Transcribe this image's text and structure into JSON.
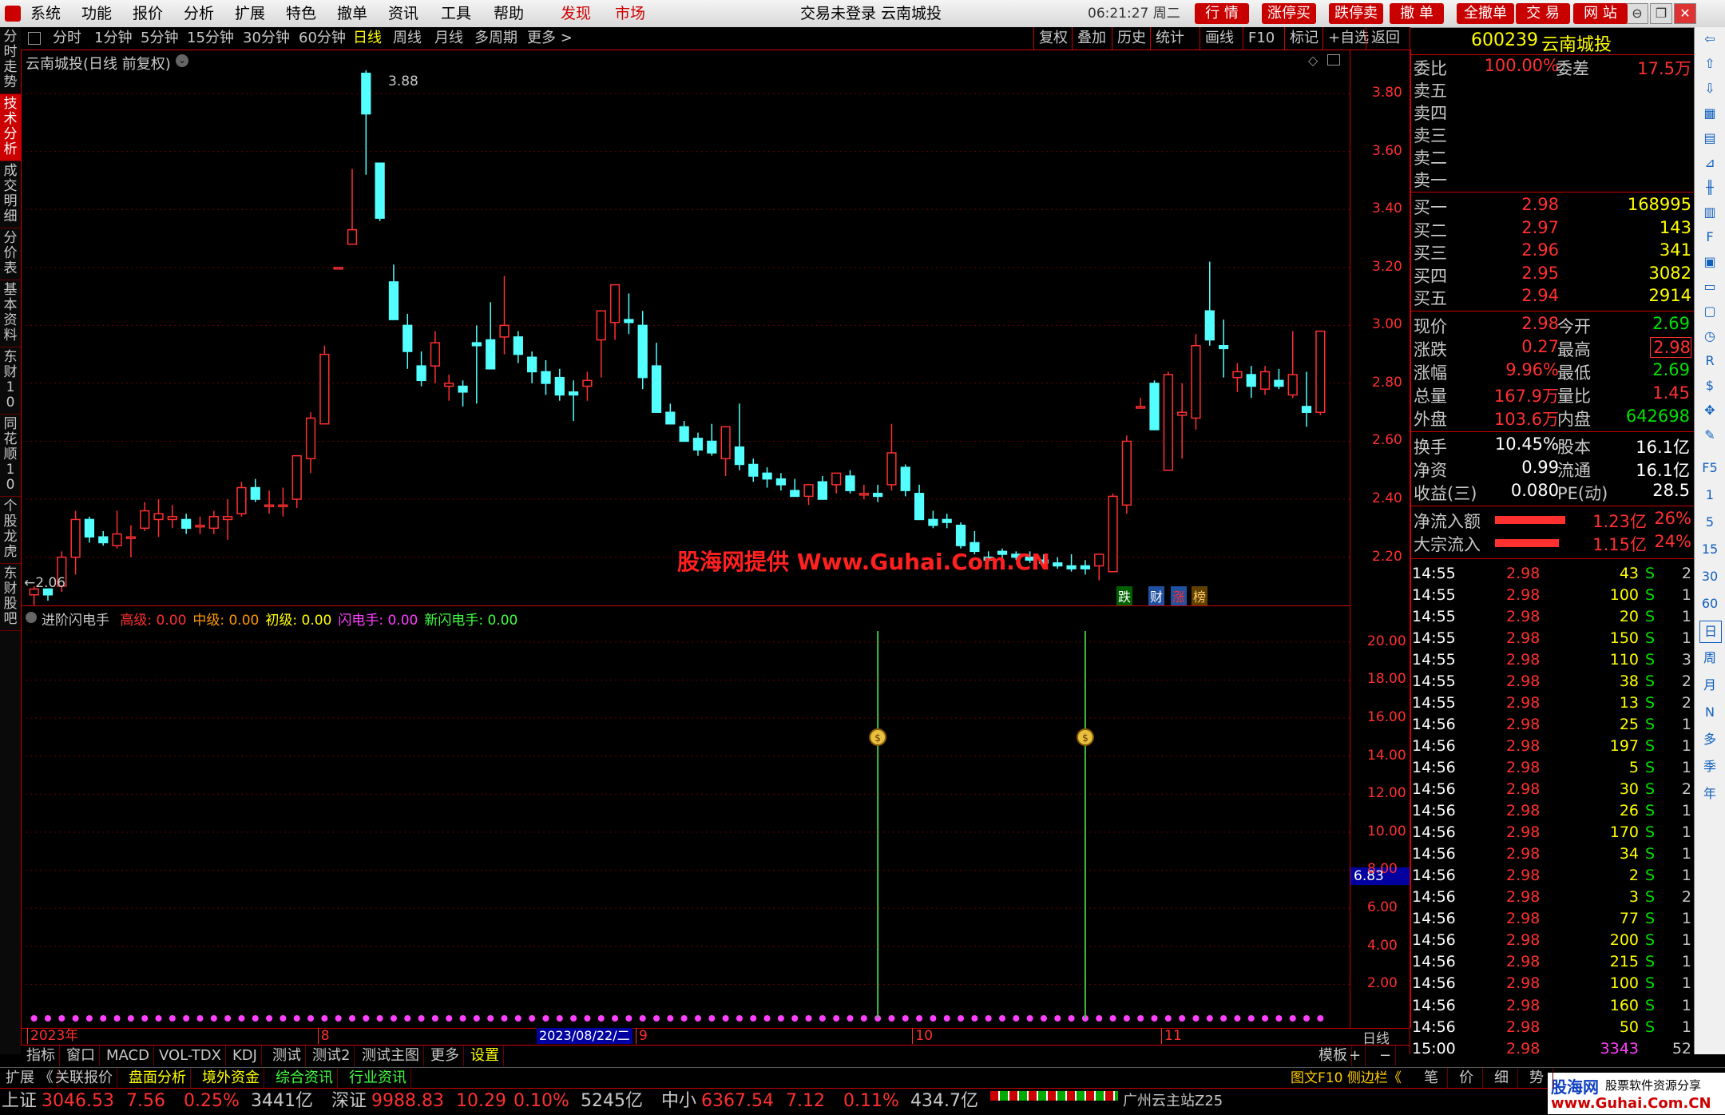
{
  "menu": {
    "items": [
      "系统",
      "功能",
      "报价",
      "分析",
      "扩展",
      "特色",
      "撤单",
      "资讯",
      "工具",
      "帮助"
    ],
    "highlight_items": [
      "发现",
      "市场"
    ],
    "window_title": "交易未登录  云南城投",
    "clock": "06:21:27 周二",
    "trade_buttons": [
      "行 情",
      "涨停买",
      "跌停卖",
      "撤 单",
      "全撤单",
      "交 易",
      "网 站"
    ]
  },
  "left_tabs": [
    "分时走势",
    "技术分析",
    "成交明细",
    "分价表",
    "基本资料",
    "东财10",
    "同花顺10",
    "个股龙虎",
    "东财股吧"
  ],
  "periods": [
    "分时",
    "1分钟",
    "5分钟",
    "15分钟",
    "30分钟",
    "60分钟",
    "日线",
    "周线",
    "月线",
    "多周期",
    "更多 >"
  ],
  "active_period": "日线",
  "tools": [
    "复权",
    "叠加",
    "历史",
    "统计",
    "画线",
    "F10",
    "标记",
    "+自选",
    "返回"
  ],
  "main_chart": {
    "title": "云南城投(日线 前复权)",
    "high_label": "3.88",
    "low_label": "2.06",
    "watermark": "股海网提供 Www.Guhai.Com.CN",
    "tags": [
      "跌",
      "财",
      "涨",
      "榜"
    ],
    "y_ticks": [
      "3.80",
      "3.60",
      "3.40",
      "3.20",
      "3.00",
      "2.80",
      "2.60",
      "2.40",
      "2.20"
    ]
  },
  "chart_data": {
    "type": "candlestick",
    "ylim": [
      2.05,
      3.93
    ],
    "candles": [
      [
        2.07,
        2.1,
        2.03,
        2.09
      ],
      [
        2.09,
        2.09,
        2.05,
        2.07
      ],
      [
        2.1,
        2.22,
        2.08,
        2.2
      ],
      [
        2.2,
        2.36,
        2.14,
        2.33
      ],
      [
        2.33,
        2.34,
        2.25,
        2.27
      ],
      [
        2.27,
        2.29,
        2.24,
        2.25
      ],
      [
        2.24,
        2.36,
        2.23,
        2.28
      ],
      [
        2.27,
        2.31,
        2.2,
        2.27
      ],
      [
        2.3,
        2.39,
        2.29,
        2.36
      ],
      [
        2.33,
        2.4,
        2.27,
        2.35
      ],
      [
        2.33,
        2.38,
        2.3,
        2.34
      ],
      [
        2.33,
        2.35,
        2.28,
        2.3
      ],
      [
        2.31,
        2.34,
        2.28,
        2.31
      ],
      [
        2.3,
        2.36,
        2.28,
        2.34
      ],
      [
        2.33,
        2.4,
        2.26,
        2.34
      ],
      [
        2.35,
        2.46,
        2.34,
        2.44
      ],
      [
        2.44,
        2.47,
        2.39,
        2.4
      ],
      [
        2.38,
        2.43,
        2.35,
        2.38
      ],
      [
        2.38,
        2.44,
        2.34,
        2.38
      ],
      [
        2.4,
        2.52,
        2.37,
        2.55
      ],
      [
        2.54,
        2.7,
        2.49,
        2.68
      ],
      [
        2.66,
        2.93,
        2.66,
        2.9
      ],
      [
        3.2,
        3.2,
        3.2,
        3.2
      ],
      [
        3.28,
        3.54,
        3.33,
        3.33
      ],
      [
        3.87,
        3.88,
        3.52,
        3.73
      ],
      [
        3.56,
        3.56,
        3.36,
        3.37
      ],
      [
        3.15,
        3.21,
        3.03,
        3.02
      ],
      [
        3.0,
        3.04,
        2.85,
        2.91
      ],
      [
        2.86,
        2.91,
        2.79,
        2.81
      ],
      [
        2.86,
        2.98,
        2.8,
        2.94
      ],
      [
        2.79,
        2.83,
        2.74,
        2.8
      ],
      [
        2.79,
        2.81,
        2.72,
        2.77
      ],
      [
        2.94,
        3.0,
        2.73,
        2.93
      ],
      [
        2.95,
        3.08,
        2.91,
        2.85
      ],
      [
        2.96,
        3.17,
        2.9,
        3.0
      ],
      [
        2.96,
        2.98,
        2.87,
        2.9
      ],
      [
        2.89,
        2.91,
        2.8,
        2.84
      ],
      [
        2.84,
        2.88,
        2.76,
        2.8
      ],
      [
        2.82,
        2.85,
        2.74,
        2.76
      ],
      [
        2.77,
        2.81,
        2.67,
        2.76
      ],
      [
        2.79,
        2.84,
        2.74,
        2.81
      ],
      [
        2.95,
        3.0,
        2.82,
        3.05
      ],
      [
        3.01,
        3.13,
        2.95,
        3.14
      ],
      [
        3.02,
        3.11,
        2.97,
        3.01
      ],
      [
        3.0,
        3.05,
        2.78,
        2.82
      ],
      [
        2.86,
        2.94,
        2.74,
        2.7
      ],
      [
        2.7,
        2.73,
        2.66,
        2.66
      ],
      [
        2.65,
        2.67,
        2.6,
        2.6
      ],
      [
        2.61,
        2.63,
        2.55,
        2.57
      ],
      [
        2.6,
        2.66,
        2.55,
        2.56
      ],
      [
        2.54,
        2.61,
        2.48,
        2.65
      ],
      [
        2.58,
        2.73,
        2.5,
        2.52
      ],
      [
        2.52,
        2.54,
        2.46,
        2.48
      ],
      [
        2.49,
        2.51,
        2.44,
        2.47
      ],
      [
        2.47,
        2.49,
        2.43,
        2.45
      ],
      [
        2.43,
        2.47,
        2.41,
        2.41
      ],
      [
        2.41,
        2.45,
        2.38,
        2.45
      ],
      [
        2.46,
        2.48,
        2.4,
        2.4
      ],
      [
        2.45,
        2.49,
        2.42,
        2.49
      ],
      [
        2.48,
        2.5,
        2.42,
        2.43
      ],
      [
        2.42,
        2.45,
        2.4,
        2.42
      ],
      [
        2.42,
        2.45,
        2.39,
        2.41
      ],
      [
        2.45,
        2.66,
        2.43,
        2.56
      ],
      [
        2.51,
        2.52,
        2.41,
        2.43
      ],
      [
        2.42,
        2.45,
        2.33,
        2.33
      ],
      [
        2.33,
        2.36,
        2.3,
        2.31
      ],
      [
        2.33,
        2.35,
        2.3,
        2.32
      ],
      [
        2.31,
        2.32,
        2.23,
        2.24
      ],
      [
        2.25,
        2.29,
        2.21,
        2.22
      ],
      [
        2.2,
        2.22,
        2.19,
        2.19
      ],
      [
        2.22,
        2.23,
        2.19,
        2.21
      ],
      [
        2.21,
        2.22,
        2.19,
        2.2
      ],
      [
        2.2,
        2.22,
        2.18,
        2.19
      ],
      [
        2.19,
        2.21,
        2.17,
        2.18
      ],
      [
        2.18,
        2.2,
        2.16,
        2.17
      ],
      [
        2.17,
        2.21,
        2.15,
        2.16
      ],
      [
        2.17,
        2.19,
        2.14,
        2.16
      ],
      [
        2.17,
        2.2,
        2.12,
        2.21
      ],
      [
        2.15,
        2.42,
        2.15,
        2.41
      ],
      [
        2.38,
        2.62,
        2.35,
        2.6
      ],
      [
        2.72,
        2.75,
        2.72,
        2.72
      ],
      [
        2.8,
        2.81,
        2.64,
        2.64
      ],
      [
        2.5,
        2.84,
        2.5,
        2.83
      ],
      [
        2.69,
        2.8,
        2.54,
        2.7
      ],
      [
        2.68,
        2.97,
        2.64,
        2.93
      ],
      [
        3.05,
        3.22,
        2.93,
        2.95
      ],
      [
        2.93,
        3.02,
        2.82,
        2.92
      ],
      [
        2.82,
        2.87,
        2.77,
        2.84
      ],
      [
        2.83,
        2.86,
        2.75,
        2.79
      ],
      [
        2.78,
        2.86,
        2.76,
        2.84
      ],
      [
        2.81,
        2.85,
        2.78,
        2.79
      ],
      [
        2.76,
        2.98,
        2.75,
        2.83
      ],
      [
        2.72,
        2.84,
        2.65,
        2.7
      ],
      [
        2.7,
        2.98,
        2.69,
        2.98
      ]
    ]
  },
  "indicator": {
    "name": "进阶闪电手",
    "labels": [
      {
        "k": "高级:",
        "v": "0.00",
        "color": "#ff3030"
      },
      {
        "k": "中级:",
        "v": "0.00",
        "color": "#ff9900"
      },
      {
        "k": "初级:",
        "v": "0.00",
        "color": "#ffff00"
      },
      {
        "k": "闪电手:",
        "v": "0.00",
        "color": "#ff40ff"
      },
      {
        "k": "新闪电手:",
        "v": "0.00",
        "color": "#40ff40"
      }
    ],
    "y_ticks": [
      "20.00",
      "18.00",
      "16.00",
      "14.00",
      "12.00",
      "10.00",
      "8.00",
      "6.00",
      "4.00",
      "2.00"
    ],
    "cursor_value": "6.83",
    "signal_positions": [
      61,
      76
    ],
    "ylim": [
      0,
      21.5
    ]
  },
  "date_axis": {
    "labels": [
      {
        "t": "2023年",
        "i": 0
      },
      {
        "t": "8",
        "i": 21
      },
      {
        "t": "9",
        "i": 44
      },
      {
        "t": "10",
        "i": 64
      },
      {
        "t": "11",
        "i": 82
      }
    ],
    "cursor_date": "2023/08/22/二",
    "unit_label": "日线"
  },
  "quote": {
    "code": "600239",
    "name": "云南城投",
    "weibi_label": "委比",
    "weibi": "100.00%",
    "weicha_label": "委差",
    "weicha": "17.5万",
    "sells": [
      "卖五",
      "卖四",
      "卖三",
      "卖二",
      "卖一"
    ],
    "buys": [
      {
        "l": "买一",
        "p": "2.98",
        "v": "168995"
      },
      {
        "l": "买二",
        "p": "2.97",
        "v": "143"
      },
      {
        "l": "买三",
        "p": "2.96",
        "v": "341"
      },
      {
        "l": "买四",
        "p": "2.95",
        "v": "3082"
      },
      {
        "l": "买五",
        "p": "2.94",
        "v": "2914"
      }
    ],
    "stats": [
      {
        "a": "现价",
        "av": "2.98",
        "ac": "red",
        "b": "今开",
        "bv": "2.69",
        "bc": "grn"
      },
      {
        "a": "涨跌",
        "av": "0.27",
        "ac": "red",
        "b": "最高",
        "bv": "2.98",
        "bc": "red",
        "boxed": true
      },
      {
        "a": "涨幅",
        "av": "9.96%",
        "ac": "red",
        "b": "最低",
        "bv": "2.69",
        "bc": "grn"
      },
      {
        "a": "总量",
        "av": "167.9万",
        "ac": "red",
        "b": "量比",
        "bv": "1.45",
        "bc": "red"
      },
      {
        "a": "外盘",
        "av": "103.6万",
        "ac": "red",
        "b": "内盘",
        "bv": "642698",
        "bc": "grn"
      }
    ],
    "fund": [
      {
        "a": "换手",
        "av": "10.45%",
        "b": "股本",
        "bv": "16.1亿"
      },
      {
        "a": "净资",
        "av": "0.99",
        "b": "流通",
        "bv": "16.1亿"
      },
      {
        "a": "收益(三)",
        "av": "0.080",
        "b": "PE(动)",
        "bv": "28.5"
      }
    ],
    "flows": [
      {
        "l": "净流入额",
        "v": "1.23亿",
        "p": "26%"
      },
      {
        "l": "大宗流入",
        "v": "1.15亿",
        "p": "24%"
      }
    ]
  },
  "ticks": [
    {
      "t": "14:55",
      "p": "2.98",
      "v": "43",
      "d": "S",
      "n": "2"
    },
    {
      "t": "14:55",
      "p": "2.98",
      "v": "100",
      "d": "S",
      "n": "1"
    },
    {
      "t": "14:55",
      "p": "2.98",
      "v": "20",
      "d": "S",
      "n": "1"
    },
    {
      "t": "14:55",
      "p": "2.98",
      "v": "150",
      "d": "S",
      "n": "1"
    },
    {
      "t": "14:55",
      "p": "2.98",
      "v": "110",
      "d": "S",
      "n": "3"
    },
    {
      "t": "14:55",
      "p": "2.98",
      "v": "38",
      "d": "S",
      "n": "2"
    },
    {
      "t": "14:55",
      "p": "2.98",
      "v": "13",
      "d": "S",
      "n": "2"
    },
    {
      "t": "14:56",
      "p": "2.98",
      "v": "25",
      "d": "S",
      "n": "1"
    },
    {
      "t": "14:56",
      "p": "2.98",
      "v": "197",
      "d": "S",
      "n": "1"
    },
    {
      "t": "14:56",
      "p": "2.98",
      "v": "5",
      "d": "S",
      "n": "1"
    },
    {
      "t": "14:56",
      "p": "2.98",
      "v": "30",
      "d": "S",
      "n": "2"
    },
    {
      "t": "14:56",
      "p": "2.98",
      "v": "26",
      "d": "S",
      "n": "1"
    },
    {
      "t": "14:56",
      "p": "2.98",
      "v": "170",
      "d": "S",
      "n": "1"
    },
    {
      "t": "14:56",
      "p": "2.98",
      "v": "34",
      "d": "S",
      "n": "1"
    },
    {
      "t": "14:56",
      "p": "2.98",
      "v": "2",
      "d": "S",
      "n": "1"
    },
    {
      "t": "14:56",
      "p": "2.98",
      "v": "3",
      "d": "S",
      "n": "2"
    },
    {
      "t": "14:56",
      "p": "2.98",
      "v": "77",
      "d": "S",
      "n": "1"
    },
    {
      "t": "14:56",
      "p": "2.98",
      "v": "200",
      "d": "S",
      "n": "1"
    },
    {
      "t": "14:56",
      "p": "2.98",
      "v": "215",
      "d": "S",
      "n": "1"
    },
    {
      "t": "14:56",
      "p": "2.98",
      "v": "100",
      "d": "S",
      "n": "1"
    },
    {
      "t": "14:56",
      "p": "2.98",
      "v": "160",
      "d": "S",
      "n": "1"
    },
    {
      "t": "14:56",
      "p": "2.98",
      "v": "50",
      "d": "S",
      "n": "1"
    },
    {
      "t": "15:00",
      "p": "2.98",
      "v": "3343",
      "d": "",
      "n": "52"
    }
  ],
  "bottom_tabs": [
    "指标",
    "窗口",
    "MACD",
    "VOL-TDX",
    "KDJ",
    "测试",
    "测试2",
    "测试主图",
    "更多",
    "设置"
  ],
  "bottom_right_tabs": [
    "模板",
    "+",
    "−"
  ],
  "bottom_tabs2": [
    "扩展",
    "关联报价",
    "盘面分析",
    "境外资金",
    "综合资讯",
    "行业资讯"
  ],
  "bottom_right2": "图文F10 侧边栏《",
  "right_bottom_tabs": [
    "笔",
    "价",
    "细",
    "势"
  ],
  "status": [
    {
      "name": "上证",
      "v": "3046.53",
      "c": "7.56",
      "p": "0.25%",
      "a": "3441亿"
    },
    {
      "name": "深证",
      "v": "9988.83",
      "c": "10.29",
      "p": "0.10%",
      "a": "5245亿"
    },
    {
      "name": "中小",
      "v": "6367.54",
      "c": "7.12",
      "p": "0.11%",
      "a": "434.7亿"
    }
  ],
  "server": "广州云主站Z25",
  "brand": "股海网",
  "brand_sub": "股票软件资源分享",
  "brand_url": "www.Guhai.Com.CN",
  "right_icons": [
    "back-icon",
    "up-icon",
    "down-icon",
    "list-icon",
    "grid-icon",
    "chart-icon",
    "candle-icon",
    "table-icon",
    "f10-icon",
    "report-icon",
    "pc-icon",
    "screen-icon",
    "clock-icon",
    "rsi-icon",
    "money-icon",
    "move-icon",
    "pen-icon"
  ],
  "right_icon_labels": [
    "F5",
    "1",
    "5",
    "15",
    "30",
    "60",
    "日",
    "周",
    "月",
    "N",
    "多",
    "季",
    "年"
  ],
  "colors": {
    "up": "#ff3030",
    "down": "#54ffff",
    "grid": "#8b0000",
    "accent": "#c80000"
  }
}
